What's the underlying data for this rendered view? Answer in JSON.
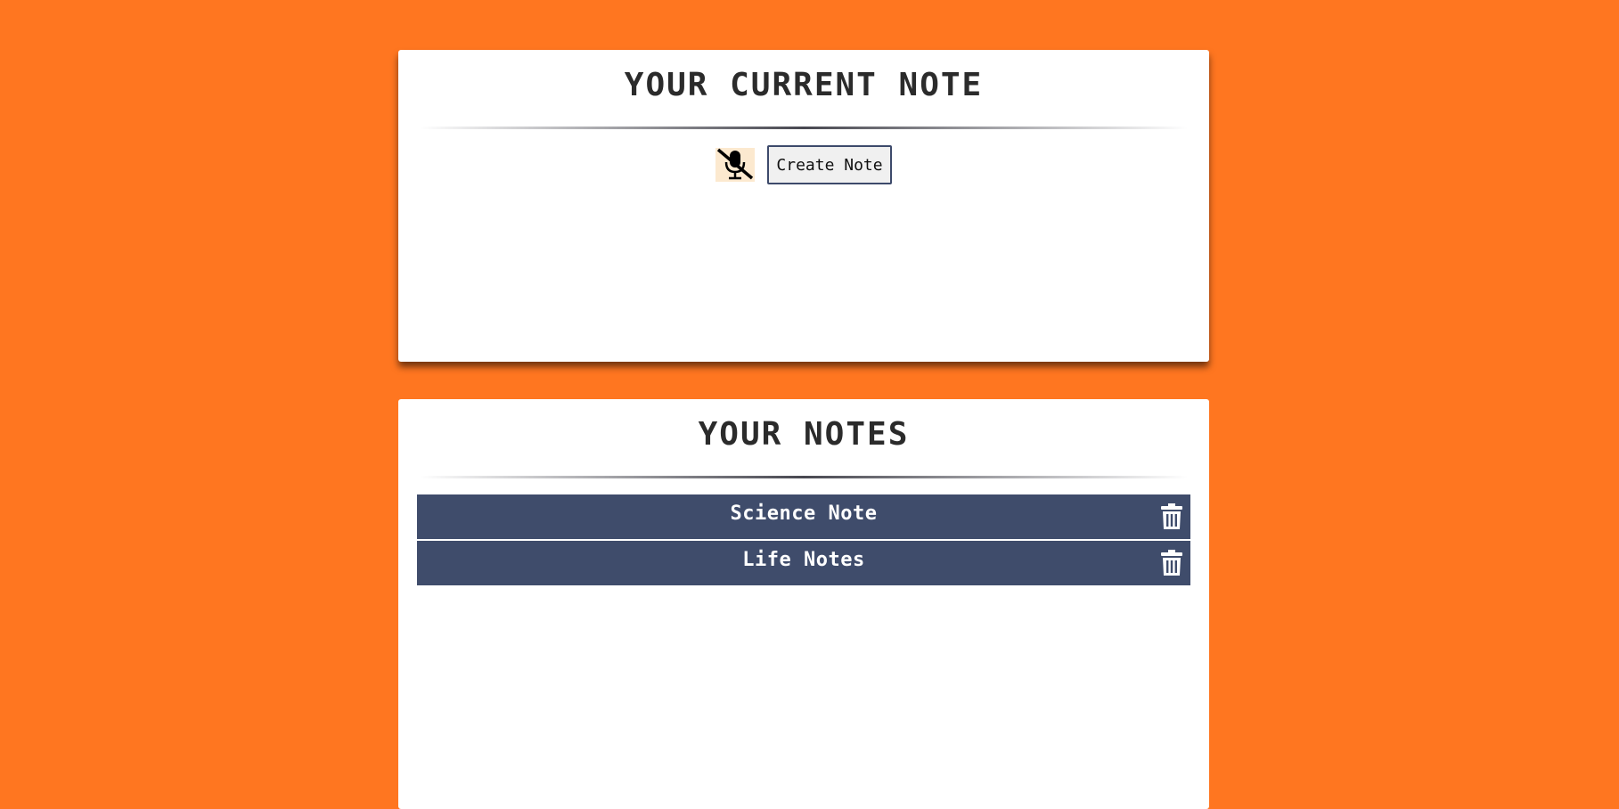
{
  "current_note": {
    "title": "YOUR CURRENT NOTE",
    "mic_icon": "microphone-slash-icon",
    "create_button_label": "Create Note"
  },
  "notes_section": {
    "title": "YOUR NOTES",
    "delete_icon": "trash-icon",
    "items": [
      {
        "title": "Science Note"
      },
      {
        "title": "Life Notes"
      }
    ]
  },
  "colors": {
    "background": "#FF7620",
    "note_item": "#3F4C6B",
    "mic_button_bg": "#FCE9CF"
  }
}
